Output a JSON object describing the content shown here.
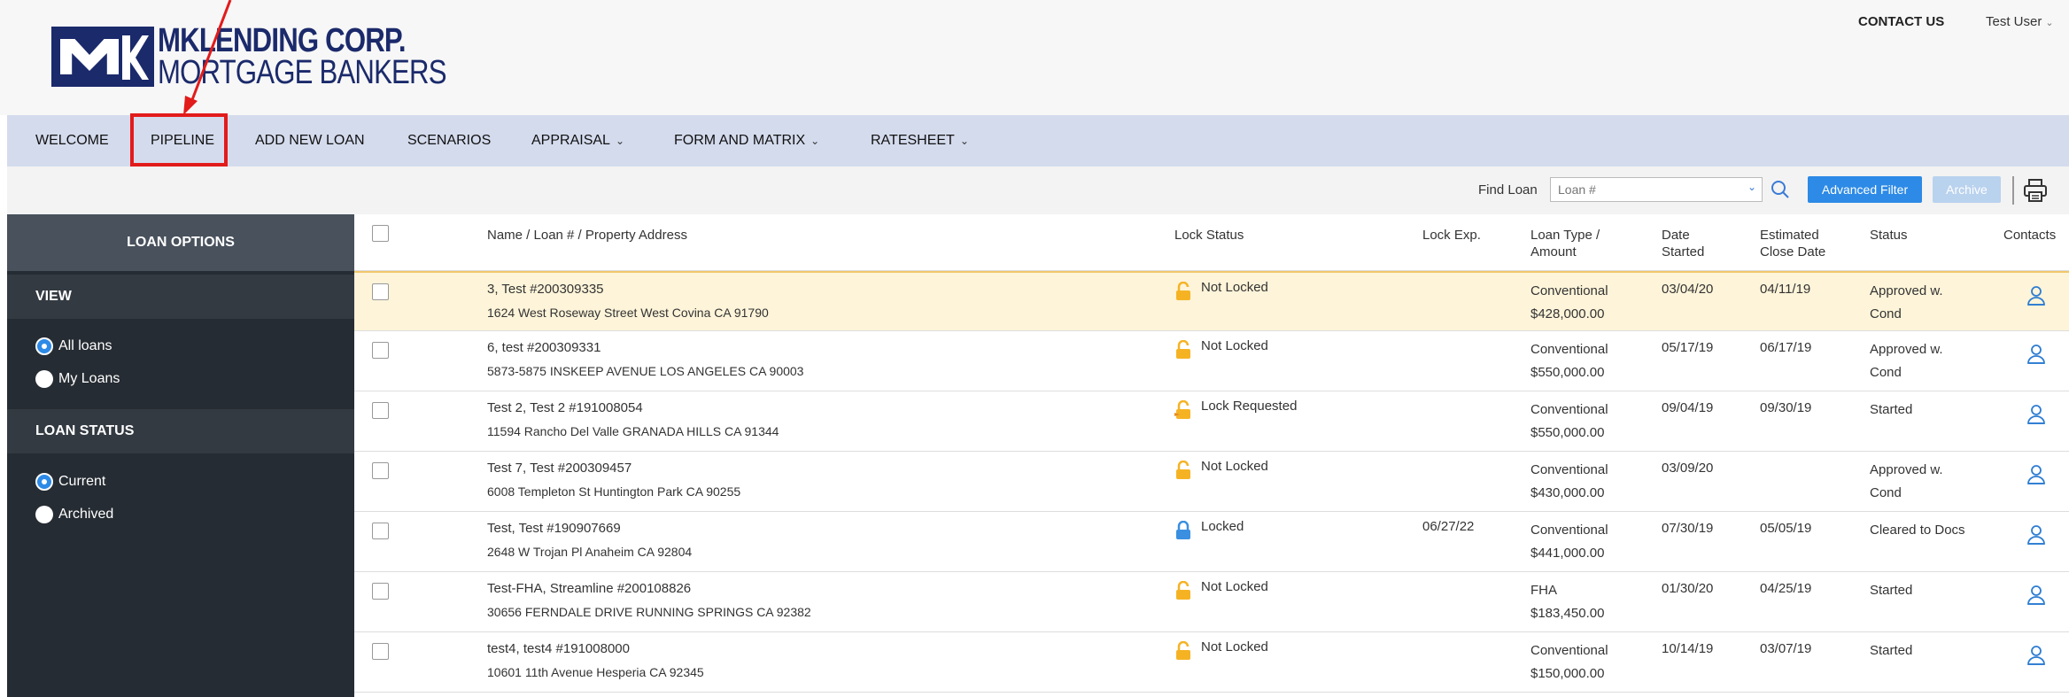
{
  "header": {
    "logo_line1": "MKLENDING CORP.",
    "logo_line2": "MORTGAGE BANKERS",
    "contact_label": "CONTACT US",
    "user_label": "Test User"
  },
  "nav": {
    "items": [
      {
        "label": "WELCOME",
        "has_menu": false
      },
      {
        "label": "PIPELINE",
        "has_menu": false,
        "highlighted": true
      },
      {
        "label": "ADD NEW LOAN",
        "has_menu": false
      },
      {
        "label": "SCENARIOS",
        "has_menu": false
      },
      {
        "label": "APPRAISAL",
        "has_menu": true
      },
      {
        "label": "FORM AND MATRIX",
        "has_menu": true
      },
      {
        "label": "RATESHEET",
        "has_menu": true
      }
    ]
  },
  "toolbar": {
    "find_label": "Find Loan",
    "find_placeholder": "Loan #",
    "advanced_filter": "Advanced Filter",
    "archive": "Archive"
  },
  "sidebar": {
    "title": "LOAN OPTIONS",
    "view_heading": "VIEW",
    "view_options": [
      {
        "label": "All loans",
        "selected": true
      },
      {
        "label": "My Loans",
        "selected": false
      }
    ],
    "status_heading": "LOAN STATUS",
    "status_options": [
      {
        "label": "Current",
        "selected": true
      },
      {
        "label": "Archived",
        "selected": false
      }
    ]
  },
  "table": {
    "headers": {
      "name": "Name / Loan # / Property Address",
      "lock_status": "Lock Status",
      "lock_exp": "Lock Exp.",
      "loan_type_1": "Loan Type /",
      "loan_type_2": "Amount",
      "date_started_1": "Date",
      "date_started_2": "Started",
      "est_close_1": "Estimated",
      "est_close_2": "Close Date",
      "status": "Status",
      "contacts": "Contacts"
    },
    "rows": [
      {
        "name": "3, Test   #200309335",
        "address": "1624 West Roseway Street West Covina CA 91790",
        "lock": "Not Locked",
        "lock_kind": "open",
        "lock_exp": "",
        "type": "Conventional",
        "amount": "$428,000.00",
        "started": "03/04/20",
        "close": "04/11/19",
        "status1": "Approved w.",
        "status2": "Cond",
        "highlight": true
      },
      {
        "name": "6, test   #200309331",
        "address": "5873-5875 INSKEEP AVENUE LOS ANGELES CA 90003",
        "lock": "Not Locked",
        "lock_kind": "open",
        "lock_exp": "",
        "type": "Conventional",
        "amount": "$550,000.00",
        "started": "05/17/19",
        "close": "06/17/19",
        "status1": "Approved w.",
        "status2": "Cond",
        "highlight": false
      },
      {
        "name": "Test 2, Test 2   #191008054",
        "address": "11594 Rancho Del Valle GRANADA HILLS CA 91344",
        "lock": "Lock Requested",
        "lock_kind": "requested",
        "lock_exp": "",
        "type": "Conventional",
        "amount": "$550,000.00",
        "started": "09/04/19",
        "close": "09/30/19",
        "status1": "Started",
        "status2": "",
        "highlight": false
      },
      {
        "name": "Test 7, Test   #200309457",
        "address": "6008 Templeton St Huntington Park CA 90255",
        "lock": "Not Locked",
        "lock_kind": "open",
        "lock_exp": "",
        "type": "Conventional",
        "amount": "$430,000.00",
        "started": "03/09/20",
        "close": "",
        "status1": "Approved w.",
        "status2": "Cond",
        "highlight": false
      },
      {
        "name": "Test, Test   #190907669",
        "address": "2648 W Trojan Pl Anaheim CA 92804",
        "lock": "Locked",
        "lock_kind": "locked",
        "lock_exp": "06/27/22",
        "type": "Conventional",
        "amount": "$441,000.00",
        "started": "07/30/19",
        "close": "05/05/19",
        "status1": "Cleared to Docs",
        "status2": "",
        "highlight": false
      },
      {
        "name": "Test-FHA, Streamline   #200108826",
        "address": "30656 FERNDALE DRIVE RUNNING SPRINGS CA 92382",
        "lock": "Not Locked",
        "lock_kind": "open",
        "lock_exp": "",
        "type": "FHA",
        "amount": "$183,450.00",
        "started": "01/30/20",
        "close": "04/25/19",
        "status1": "Started",
        "status2": "",
        "highlight": false
      },
      {
        "name": "test4, test4   #191008000",
        "address": "10601 11th Avenue Hesperia CA 92345",
        "lock": "Not Locked",
        "lock_kind": "open",
        "lock_exp": "",
        "type": "Conventional",
        "amount": "$150,000.00",
        "started": "10/14/19",
        "close": "03/07/19",
        "status1": "Started",
        "status2": "",
        "highlight": false
      }
    ]
  },
  "colors": {
    "brand_navy": "#1b2a6b",
    "nav_bg": "#d4dbed",
    "accent_blue": "#2d8ae6",
    "lock_open": "#f5b324",
    "lock_closed": "#3a8fe0",
    "highlight_row": "#fdf4d9",
    "annotation_red": "#e21b1b"
  }
}
